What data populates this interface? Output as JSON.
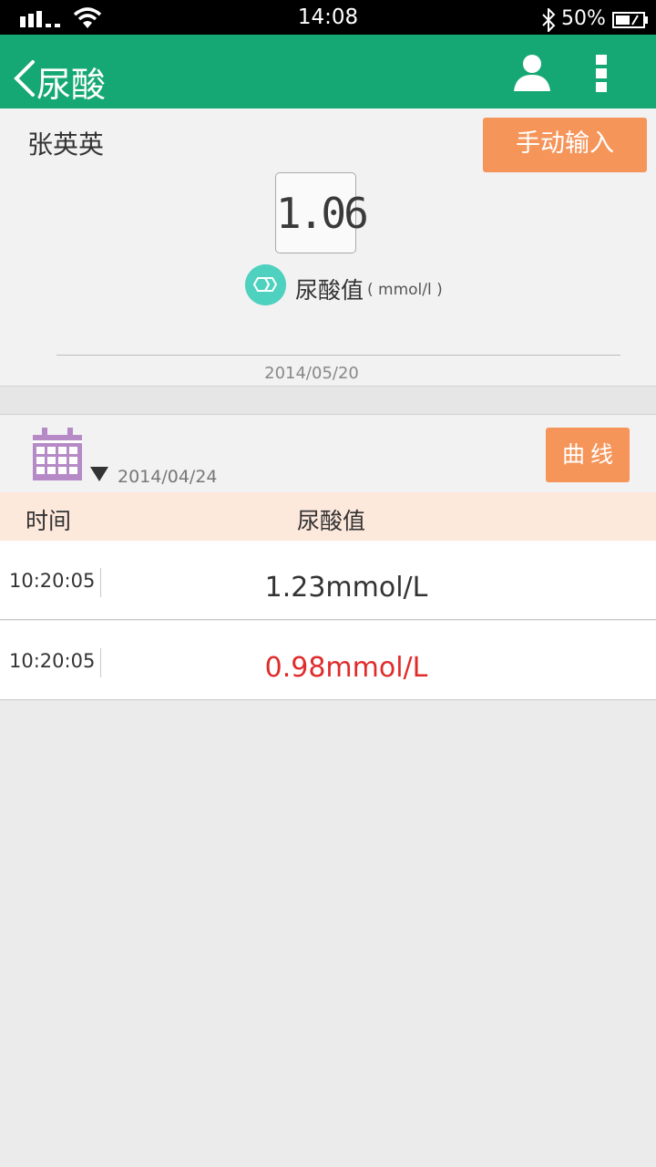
{
  "status_bar": {
    "time": "14:08",
    "battery": "50%"
  },
  "app_bar": {
    "title": "尿酸"
  },
  "summary": {
    "patient_name": "张英英",
    "manual_input_label": "手动输入",
    "value": "1.06",
    "metric_label": "尿酸值",
    "metric_unit": "( mmol/l )",
    "date": "2014/05/20"
  },
  "history": {
    "date": "2014/04/24",
    "curve_label": "曲线",
    "columns": {
      "time": "时间",
      "value": "尿酸值"
    },
    "rows": [
      {
        "time": "10:20:05",
        "value": "1.23mmol/L",
        "abnormal": false
      },
      {
        "time": "10:20:05",
        "value": "0.98mmol/L",
        "abnormal": true
      }
    ]
  },
  "colors": {
    "app_bar": "#16a874",
    "accent_button": "#f5955a",
    "table_header": "#fde8dc",
    "abnormal_value": "#e02b2b",
    "metric_icon": "#4fd1bf",
    "calendar_icon": "#b58ac6"
  }
}
